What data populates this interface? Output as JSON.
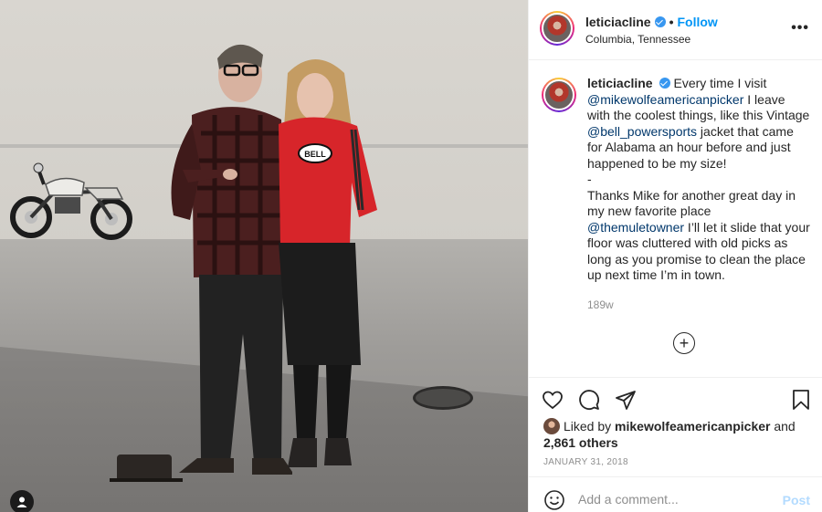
{
  "post": {
    "username": "leticiacline",
    "follow_label": "Follow",
    "dot": "•",
    "location": "Columbia, Tennessee",
    "more_label": "•••"
  },
  "caption": {
    "username": "leticiacline",
    "text1": "Every time I visit ",
    "mention1": "@mikewolfeamericanpicker",
    "text2": " I leave with the coolest things, like this Vintage ",
    "mention2": "@bell_powersports",
    "text3": " jacket that came for Alabama an hour before and just happened to be my size!",
    "dash": "-",
    "text4": "Thanks Mike for another great day in my new favorite place ",
    "mention3": "@themuletowner",
    "text5": " I’ll let it slide that your floor was cluttered with old picks as long as you promise to clean the place up next time I’m in town.",
    "time_ago": "189w"
  },
  "load_more": "+",
  "likes": {
    "prefix": "Liked by ",
    "user": "mikewolfeamericanpicker",
    "and": " and ",
    "count": "2,861 others"
  },
  "date": "JANUARY 31, 2018",
  "comment": {
    "placeholder": "Add a comment...",
    "post_label": "Post"
  },
  "icons": {
    "like": "heart-icon",
    "comment": "comment-icon",
    "share": "paper-plane-icon",
    "save": "bookmark-icon",
    "emoji": "smiley-icon",
    "more": "more-options-icon",
    "tag": "user-tag-icon"
  },
  "colors": {
    "follow": "#0095f6",
    "verified": "#3897f0",
    "mention": "#00376b",
    "post_disabled": "#b3dbff",
    "muted": "#8e8e8e"
  }
}
